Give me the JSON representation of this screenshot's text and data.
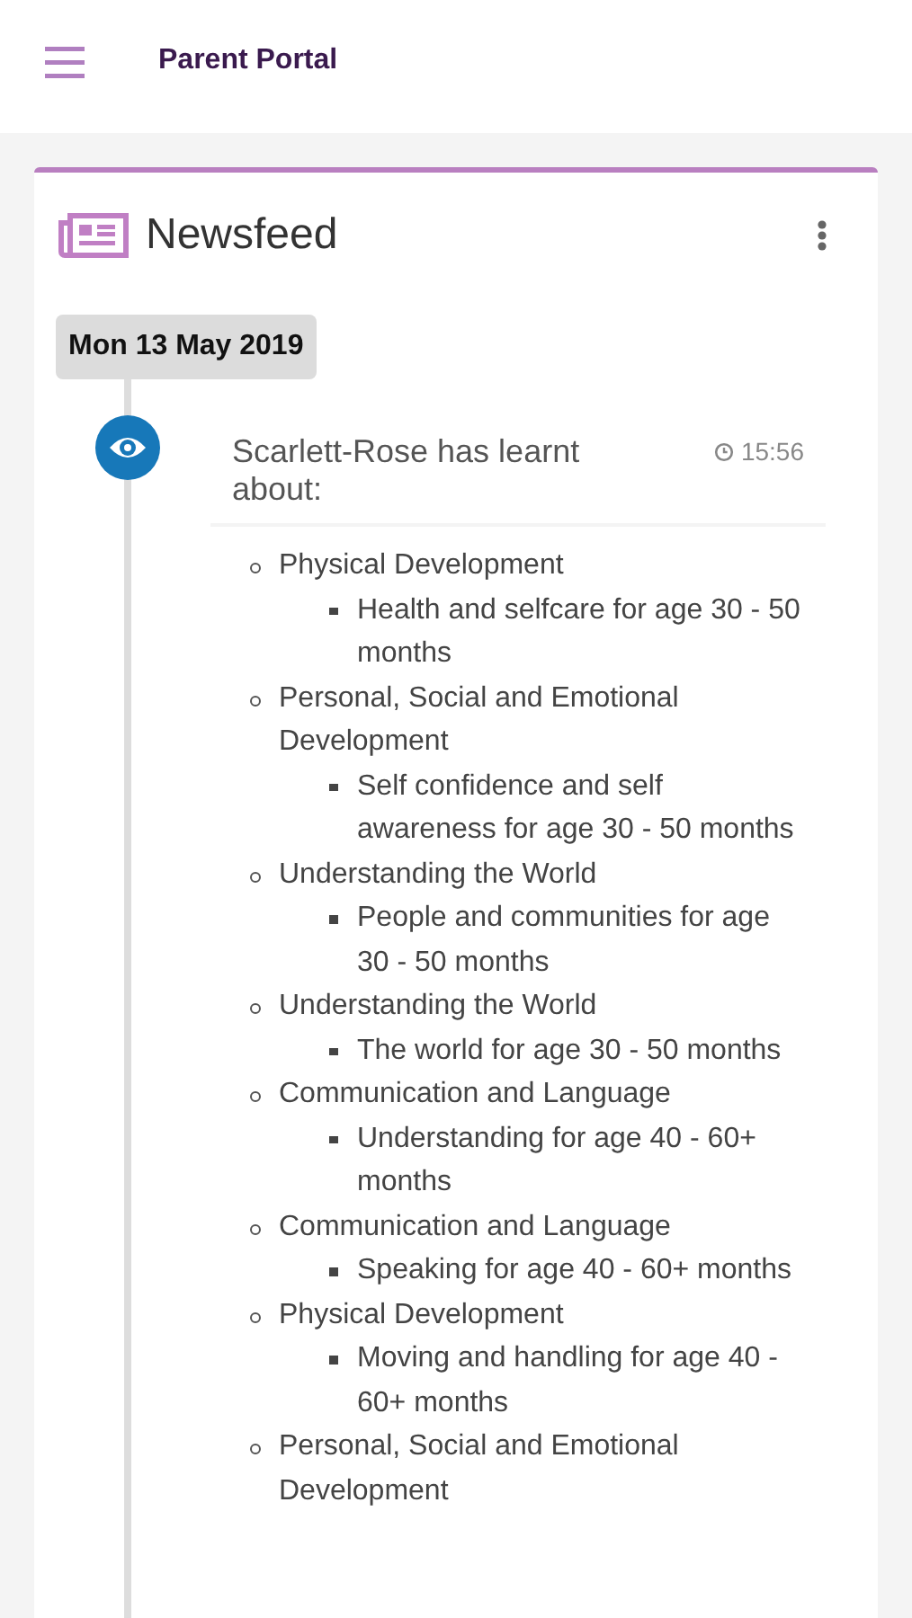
{
  "header": {
    "title": "Parent Portal"
  },
  "card": {
    "title": "Newsfeed",
    "date": "Mon 13 May 2019",
    "entry": {
      "text": "Scarlett-Rose has learnt about:",
      "time": "15:56",
      "items": [
        {
          "label": "Physical Development",
          "children": [
            {
              "label": "Health and selfcare for age 30 - 50 months"
            }
          ]
        },
        {
          "label": "Personal, Social and Emotional Development",
          "children": [
            {
              "label": "Self confidence and self awareness for age 30 - 50 months"
            }
          ]
        },
        {
          "label": "Understanding the World",
          "children": [
            {
              "label": "People and communities for age 30 - 50 months"
            }
          ]
        },
        {
          "label": "Understanding the World",
          "children": [
            {
              "label": "The world for age 30 - 50 months"
            }
          ]
        },
        {
          "label": "Communication and Language",
          "children": [
            {
              "label": "Understanding for age 40 - 60+ months"
            }
          ]
        },
        {
          "label": "Communication and Language",
          "children": [
            {
              "label": "Speaking for age 40 - 60+ months"
            }
          ]
        },
        {
          "label": "Physical Development",
          "children": [
            {
              "label": "Moving and handling for age 40 - 60+ months"
            }
          ]
        },
        {
          "label": "Personal, Social and Emotional Development"
        }
      ]
    }
  }
}
